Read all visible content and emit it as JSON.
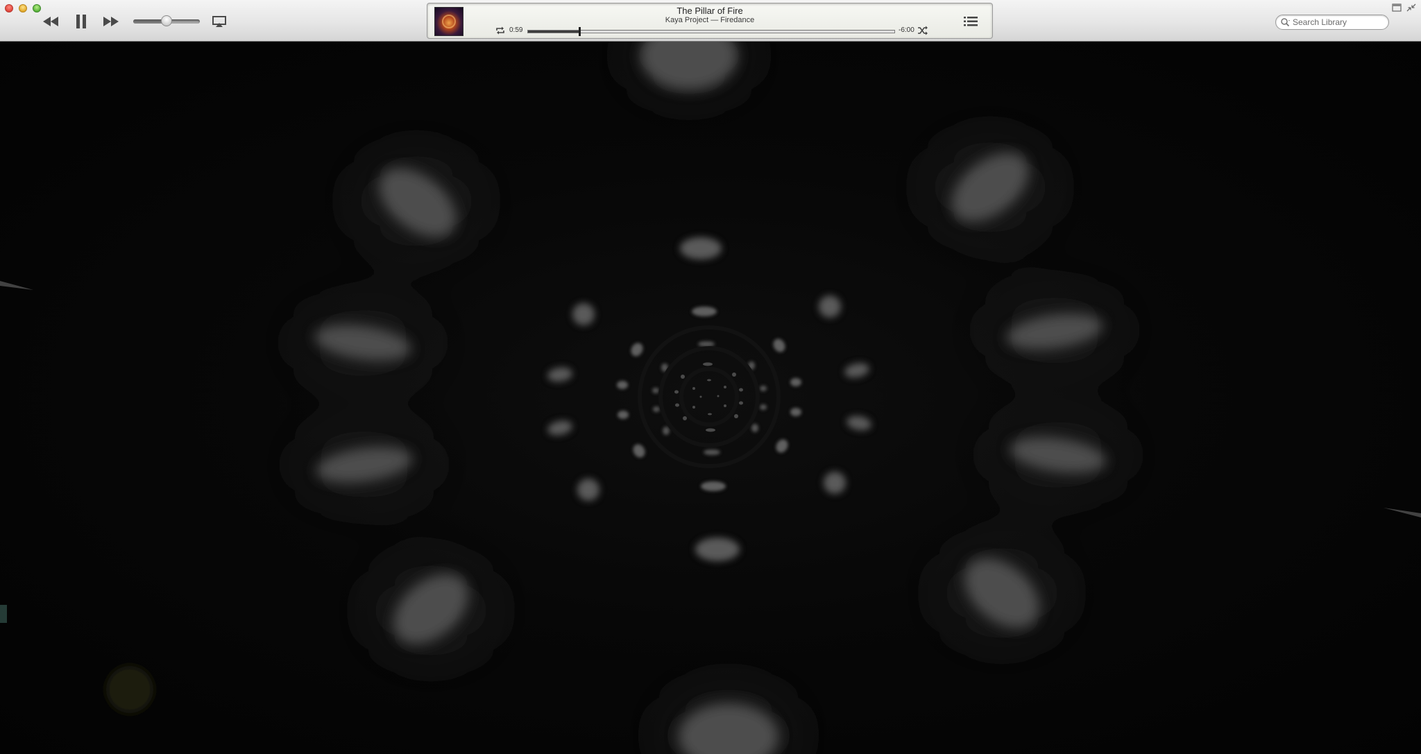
{
  "player": {
    "now_playing": {
      "title": "The Pillar of Fire",
      "artist": "Kaya Project",
      "album": "Firedance",
      "subtitle": "Kaya Project — Firedance",
      "elapsed": "0:59",
      "remaining": "-6:00",
      "progress_fraction": 0.14
    },
    "volume_fraction": 0.5
  },
  "search": {
    "placeholder": "Search Library"
  },
  "icons": {
    "previous": "rewind-icon",
    "play_pause": "pause-icon",
    "next": "fast-forward-icon",
    "airplay": "airplay-icon",
    "repeat": "repeat-icon",
    "shuffle": "shuffle-icon",
    "up_next": "list-icon",
    "search": "search-icon",
    "miniplayer": "miniplayer-icon",
    "fullscreen": "exit-fullscreen-icon"
  },
  "colors": {
    "toolbar": "#e6e6e6",
    "visualizer_background": "#050505",
    "visualizer_blob": "#555555"
  }
}
